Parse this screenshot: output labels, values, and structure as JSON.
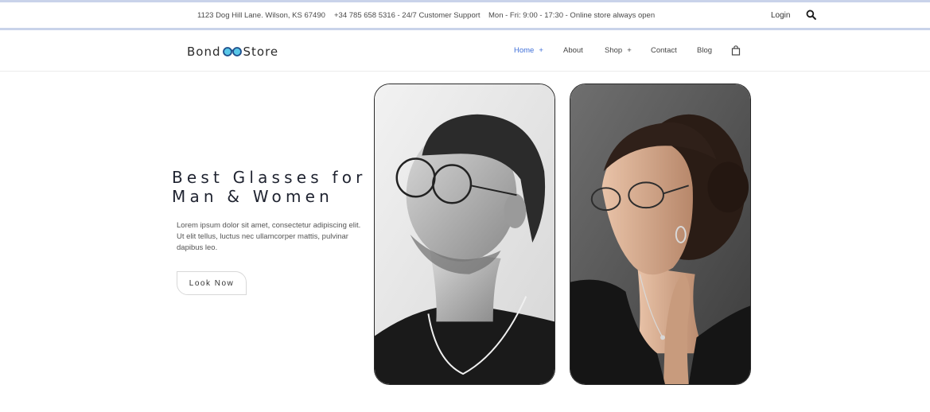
{
  "topbar": {
    "address": "1123 Dog Hill Lane. Wilson, KS 67490",
    "phone": "+34 785 658 5316 - 24/7 Customer Support",
    "hours": "Mon - Fri: 9:00 - 17:30 - Online store always open",
    "login_label": "Login",
    "search_icon": "search-icon"
  },
  "nav": {
    "logo": {
      "left": "Bond",
      "right": "Store",
      "icon": "glasses-icon"
    },
    "items": [
      {
        "label": "Home",
        "suffix": "+",
        "active": true
      },
      {
        "label": "About"
      },
      {
        "label": "Shop",
        "suffix": "+"
      },
      {
        "label": "Contact"
      },
      {
        "label": "Blog"
      }
    ],
    "cart_icon": "shopping-bag-icon",
    "active_color": "#3f6fd8"
  },
  "hero": {
    "title_line1": "Best Glasses for",
    "title_line2": "Man & Women",
    "text": "Lorem ipsum dolor sit amet, consectetur adipiscing elit. Ut elit tellus, luctus nec ullamcorper mattis, pulvinar dapibus leo.",
    "cta_label": "Look Now"
  },
  "images": [
    {
      "name": "man-with-glasses-photo"
    },
    {
      "name": "woman-with-glasses-photo"
    }
  ]
}
